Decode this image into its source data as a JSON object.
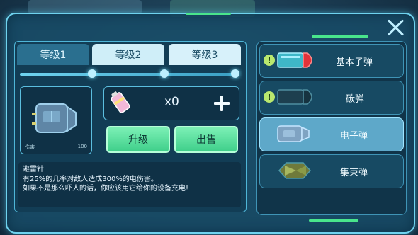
{
  "tabs": [
    {
      "label": "等级1"
    },
    {
      "label": "等级2"
    },
    {
      "label": "等级3"
    }
  ],
  "item": {
    "stat_label": "伤害",
    "stat_value": "100",
    "quantity": "x0"
  },
  "buttons": {
    "upgrade": "升级",
    "sell": "出售"
  },
  "description": {
    "title": "避雷针",
    "line1": "有25%的几率对敌人造成300%的电伤害。",
    "line2": "如果不是那么吓人的话，你应该用它给你的设备充电!"
  },
  "ammo_list": [
    {
      "label": "基本子弹",
      "alert": "!",
      "icon": "red-bullet-icon",
      "selected": false
    },
    {
      "label": "碳弹",
      "alert": "!",
      "icon": "dark-bullet-icon",
      "selected": false
    },
    {
      "label": "电子弹",
      "icon": "electric-bullet-icon",
      "selected": true
    },
    {
      "label": "集束弹",
      "icon": "cluster-bullet-icon",
      "selected": false
    }
  ],
  "colors": {
    "accent_green": "#49e58c",
    "panel_border": "#6fd3ef",
    "selected_row": "#5ea8c9"
  }
}
